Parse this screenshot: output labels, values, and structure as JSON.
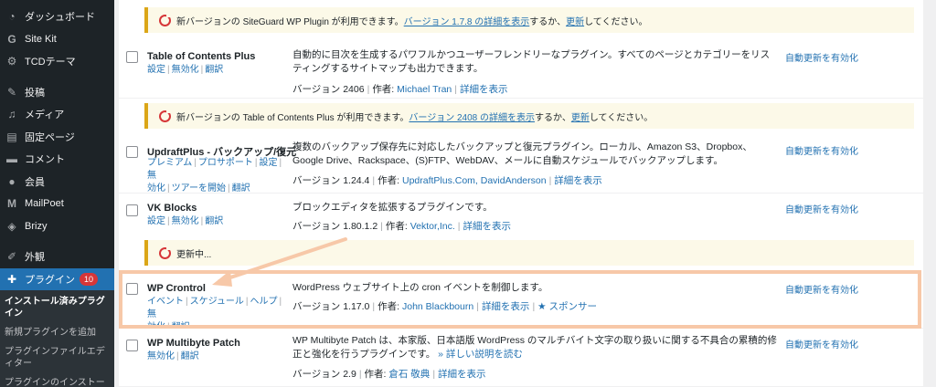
{
  "sidebar": {
    "items": [
      {
        "label": "ダッシュボード",
        "icon": "gauge-icon"
      },
      {
        "label": "Site Kit",
        "icon": "g-icon"
      },
      {
        "label": "TCDテーマ",
        "icon": "gear-icon"
      },
      {
        "label": "投稿",
        "icon": "pin-icon"
      },
      {
        "label": "メディア",
        "icon": "media-icon"
      },
      {
        "label": "固定ページ",
        "icon": "page-icon"
      },
      {
        "label": "コメント",
        "icon": "comment-icon"
      },
      {
        "label": "会員",
        "icon": "user-icon"
      },
      {
        "label": "MailPoet",
        "icon": "m-icon"
      },
      {
        "label": "Brizy",
        "icon": "brizy-icon"
      },
      {
        "label": "外観",
        "icon": "brush-icon"
      },
      {
        "label": "プラグイン",
        "icon": "plug-icon",
        "badge": "10"
      }
    ],
    "submenu": [
      "インストール済みプラグイン",
      "新規プラグインを追加",
      "プラグインファイルエディター",
      "プラグインのインストー"
    ]
  },
  "plugins": {
    "notice1": {
      "prefix": "新バージョンの SiteGuard WP Plugin が利用できます。",
      "link": "バージョン 1.7.8 の詳細を表示",
      "mid": "するか、",
      "update": "更新",
      "suffix": "してください。"
    },
    "toc": {
      "name": "Table of Contents Plus",
      "actions": [
        "設定",
        "無効化",
        "翻訳"
      ],
      "desc": "自動的に目次を生成するパワフルかつユーザーフレンドリーなプラグイン。すべてのページとカテゴリーをリスティングするサイトマップも出力できます。",
      "version": "バージョン 2406",
      "author_label": "作者:",
      "author": "Michael Tran",
      "details": "詳細を表示",
      "auto": "自動更新を有効化"
    },
    "notice2": {
      "prefix": "新バージョンの Table of Contents Plus が利用できます。",
      "link": "バージョン 2408 の詳細を表示",
      "mid": "するか、",
      "update": "更新",
      "suffix": "してください。"
    },
    "updraft": {
      "name": "UpdraftPlus - バックアップ/復元",
      "actions_l1": [
        "プレミアム",
        "プロサポート",
        "設定",
        "無"
      ],
      "actions_l2": [
        "効化",
        "ツアーを開始",
        "翻訳"
      ],
      "desc": "複数のバックアップ保存先に対応したバックアップと復元プラグイン。ローカル、Amazon S3、Dropbox、Google Drive、Rackspace、(S)FTP、WebDAV、メールに自動スケジュールでバックアップします。",
      "version": "バージョン 1.24.4",
      "author_label": "作者:",
      "author": "UpdraftPlus.Com, DavidAnderson",
      "details": "詳細を表示",
      "auto": "自動更新を有効化"
    },
    "vk": {
      "name": "VK Blocks",
      "actions": [
        "設定",
        "無効化",
        "翻訳"
      ],
      "desc": "ブロックエディタを拡張するプラグインです。",
      "version": "バージョン 1.80.1.2",
      "author_label": "作者:",
      "author": "Vektor,Inc.",
      "details": "詳細を表示",
      "auto": "自動更新を有効化"
    },
    "notice3": {
      "text": "更新中..."
    },
    "wpcron": {
      "name": "WP Crontrol",
      "actions_l1": [
        "イベント",
        "スケジュール",
        "ヘルプ",
        "無"
      ],
      "actions_l2": [
        "効化",
        "翻訳"
      ],
      "desc": "WordPress ウェブサイト上の cron イベントを制御します。",
      "version": "バージョン 1.17.0",
      "author_label": "作者:",
      "author": "John Blackbourn",
      "details": "詳細を表示",
      "sponsor": "スポンサー",
      "auto": "自動更新を有効化"
    },
    "mbp": {
      "name": "WP Multibyte Patch",
      "actions": [
        "無効化",
        "翻訳"
      ],
      "desc": "WP Multibyte Patch は、本家版、日本語版 WordPress のマルチバイト文字の取り扱いに関する不具合の累積的修正と強化を行うプラグインです。",
      "more": "» 詳しい説明を読む",
      "version": "バージョン 2.9",
      "author_label": "作者:",
      "author": "倉石 敬典",
      "details": "詳細を表示",
      "auto": "自動更新を有効化"
    }
  },
  "colors": {
    "accent": "#2271b1",
    "highlight": "#f7c8a8",
    "warning": "#dba617",
    "error": "#d63638"
  }
}
